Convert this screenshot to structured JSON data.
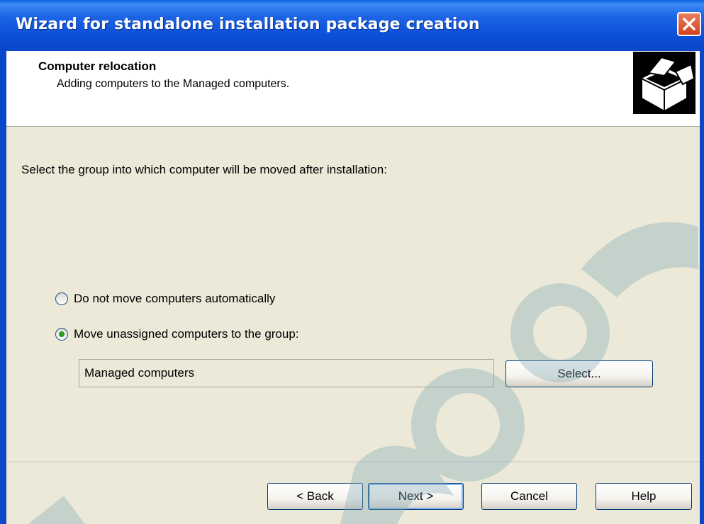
{
  "window": {
    "title": "Wizard for standalone installation package creation",
    "close_icon": "close-icon"
  },
  "header": {
    "title": "Computer relocation",
    "subtitle": "Adding computers to the Managed computers.",
    "icon": "open-box-icon"
  },
  "body": {
    "prompt": "Select the group into which computer will be moved after installation:",
    "options": [
      {
        "label": "Do not move computers automatically",
        "checked": false
      },
      {
        "label": "Move unassigned computers to the group:",
        "checked": true
      }
    ],
    "group_value": "Managed computers",
    "select_button": "Select..."
  },
  "footer": {
    "back": "< Back",
    "next": "Next >",
    "cancel": "Cancel",
    "help": "Help"
  },
  "colors": {
    "titlebar": "#0a48c9",
    "dialog_bg": "#ece9d8",
    "watermark": "#7fa8b5"
  }
}
